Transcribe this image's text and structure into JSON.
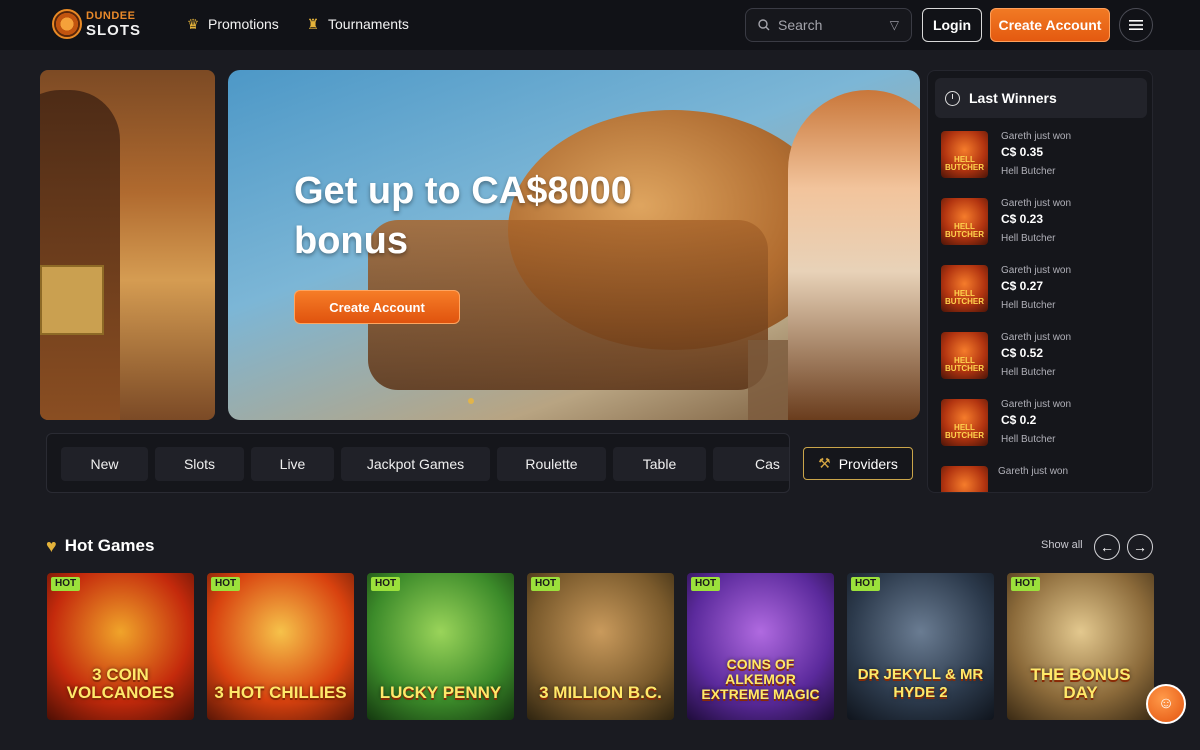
{
  "header": {
    "logo_top": "DUNDEE",
    "logo_bottom": "SLOTS",
    "nav": [
      {
        "label": "Promotions",
        "icon": "trophy-icon"
      },
      {
        "label": "Tournaments",
        "icon": "cup-icon"
      }
    ],
    "search_placeholder": "Search",
    "login_label": "Login",
    "create_account_label": "Create Account"
  },
  "hero": {
    "title": "Get up to CA$8000 bonus",
    "cta_label": "Create Account"
  },
  "winners": {
    "title": "Last Winners",
    "items": [
      {
        "who": "Gareth just won",
        "amount": "C$ 0.35",
        "game": "Hell Butcher",
        "thumb_text": "HELL BUTCHER"
      },
      {
        "who": "Gareth just won",
        "amount": "C$ 0.23",
        "game": "Hell Butcher",
        "thumb_text": "HELL BUTCHER"
      },
      {
        "who": "Gareth just won",
        "amount": "C$ 0.27",
        "game": "Hell Butcher",
        "thumb_text": "HELL BUTCHER"
      },
      {
        "who": "Gareth just won",
        "amount": "C$ 0.52",
        "game": "Hell Butcher",
        "thumb_text": "HELL BUTCHER"
      },
      {
        "who": "Gareth just won",
        "amount": "C$ 0.2",
        "game": "Hell Butcher",
        "thumb_text": "HELL BUTCHER"
      },
      {
        "who": "Gareth just won",
        "amount": "",
        "game": "",
        "thumb_text": ""
      }
    ]
  },
  "categories": [
    "New",
    "Slots",
    "Live",
    "Jackpot Games",
    "Roulette",
    "Table",
    "Cas"
  ],
  "providers_label": "Providers",
  "hot_games": {
    "title": "Hot Games",
    "show_all": "Show all",
    "tag": "HOT",
    "items": [
      {
        "name": "3 COIN VOLCANOES",
        "bg": "#c42a0c"
      },
      {
        "name": "3 HOT CHILLIES",
        "bg": "#d8420f"
      },
      {
        "name": "LUCKY PENNY",
        "bg": "#3c8b2a"
      },
      {
        "name": "3 MILLION B.C.",
        "bg": "#7a5a2c"
      },
      {
        "name": "COINS OF ALKEMOR EXTREME MAGIC",
        "bg": "#5b2a9c"
      },
      {
        "name": "DR JEKYLL & MR HYDE 2",
        "bg": "#2c3a4c"
      },
      {
        "name": "THE BONUS DAY",
        "bg": "#8b6a3a"
      }
    ]
  },
  "colors": {
    "accent": "#f17a24",
    "gold": "#e3b23a",
    "hot_tag": "#9be13b"
  }
}
